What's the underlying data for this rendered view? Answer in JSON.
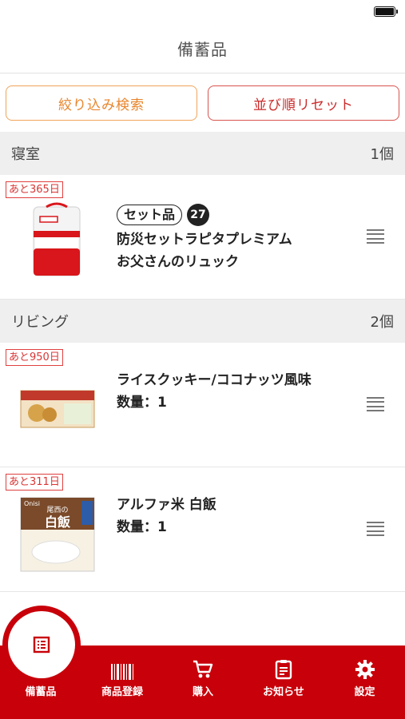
{
  "nav": {
    "title": "備蓄品"
  },
  "filters": {
    "filter_label": "絞り込み検索",
    "reset_label": "並び順リセット"
  },
  "sections": [
    {
      "name": "寝室",
      "count": "1個",
      "items": [
        {
          "days": "あと365日",
          "tag": "セット品",
          "tag_count": "27",
          "line1": "防災セットラピタプレミアム",
          "line2": "お父さんのリュック"
        }
      ]
    },
    {
      "name": "リビング",
      "count": "2個",
      "items": [
        {
          "days": "あと950日",
          "line1": "ライスクッキー/ココナッツ風味",
          "line2": "数量：1"
        },
        {
          "days": "あと311日",
          "line1": "アルファ米 白飯",
          "line2": "数量：1",
          "package": {
            "brand": "Onisi",
            "title1": "尾西の",
            "title2": "白飯"
          }
        }
      ]
    }
  ],
  "tabs": [
    {
      "label": "備蓄品",
      "icon": "list-icon",
      "active": true
    },
    {
      "label": "商品登録",
      "icon": "barcode-icon"
    },
    {
      "label": "購入",
      "icon": "cart-icon"
    },
    {
      "label": "お知らせ",
      "icon": "notice-icon"
    },
    {
      "label": "設定",
      "icon": "gear-icon"
    }
  ],
  "colors": {
    "accent": "#c8000a",
    "filter": "#e8862d",
    "reset": "#cc2b2b",
    "badge": "#d93636"
  }
}
